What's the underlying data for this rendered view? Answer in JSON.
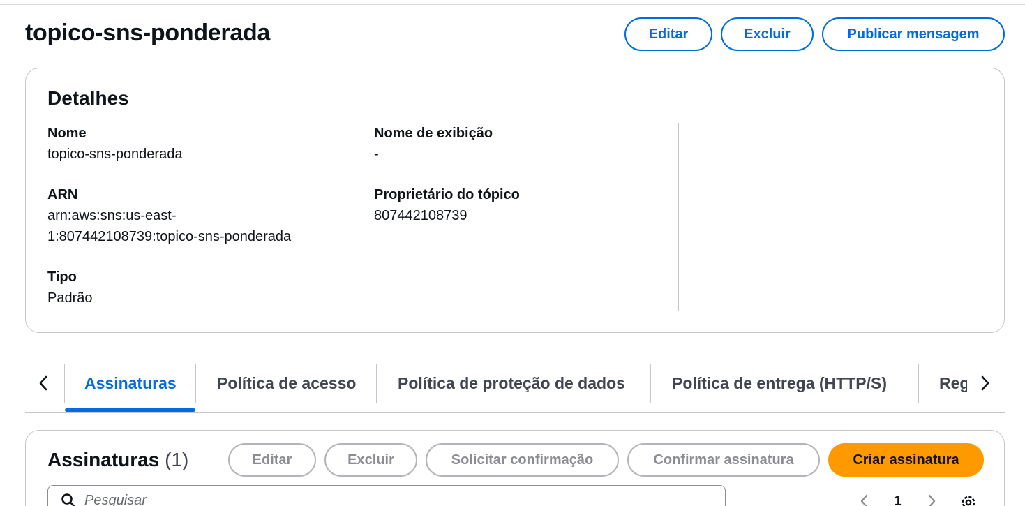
{
  "header": {
    "title": "topico-sns-ponderada",
    "edit_label": "Editar",
    "delete_label": "Excluir",
    "publish_label": "Publicar mensagem"
  },
  "details": {
    "title": "Detalhes",
    "name_label": "Nome",
    "name_value": "topico-sns-ponderada",
    "arn_label": "ARN",
    "arn_value_line1": "arn:aws:sns:us-east-",
    "arn_value_line2": "1:807442108739:topico-sns-ponderada",
    "type_label": "Tipo",
    "type_value": "Padrão",
    "display_name_label": "Nome de exibição",
    "display_name_value": "-",
    "owner_label": "Proprietário do tópico",
    "owner_value": "807442108739"
  },
  "tabs": {
    "items": [
      {
        "label": "Assinaturas",
        "active": true
      },
      {
        "label": "Política de acesso",
        "active": false
      },
      {
        "label": "Política de proteção de dados",
        "active": false
      },
      {
        "label": "Política de entrega (HTTP/S)",
        "active": false
      },
      {
        "label": "Reg",
        "active": false
      }
    ],
    "prev_icon": "chevron-left-icon",
    "next_icon": "chevron-right-icon"
  },
  "subscriptions": {
    "title": "Assinaturas",
    "count": "(1)",
    "edit_label": "Editar",
    "delete_label": "Excluir",
    "request_label": "Solicitar confirmação",
    "confirm_label": "Confirmar assinatura",
    "create_label": "Criar assinatura",
    "search_placeholder": "Pesquisar",
    "page": "1"
  },
  "colors": {
    "accent": "#006ce0",
    "primary_button": "#ff9900",
    "disabled": "#8c8c94"
  }
}
